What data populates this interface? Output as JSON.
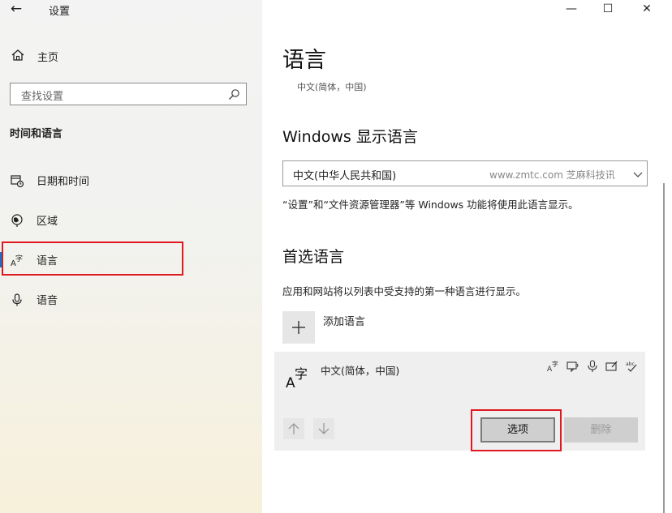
{
  "app": {
    "title": "设置"
  },
  "sidebar": {
    "home_label": "主页",
    "search_placeholder": "查找设置",
    "section_heading": "时间和语言",
    "items": [
      {
        "label": "日期和时间",
        "icon": "calendar-clock-icon"
      },
      {
        "label": "区域",
        "icon": "globe-region-icon"
      },
      {
        "label": "语言",
        "icon": "language-icon",
        "selected": true
      },
      {
        "label": "语音",
        "icon": "microphone-icon"
      }
    ]
  },
  "window_controls": {
    "minimize": "—",
    "maximize": "☐",
    "close": "✕"
  },
  "main": {
    "title": "语言",
    "subtitle": "中文(简体，中国)",
    "display_language": {
      "heading": "Windows 显示语言",
      "selected_value": "中文(中华人民共和国)",
      "watermark": "www.zmtc.com 芝麻科技讯",
      "description": "“设置”和“文件资源管理器”等 Windows 功能将使用此语言显示。"
    },
    "preferred": {
      "heading": "首选语言",
      "description": "应用和网站将以列表中受支持的第一种语言进行显示。",
      "add_label": "添加语言",
      "languages": [
        {
          "name": "中文(简体，中国)",
          "glyph": "字"
        }
      ],
      "options_label": "选项",
      "delete_label": "删除"
    }
  },
  "colors": {
    "accent": "#0078d7",
    "highlight_red": "#e0181f",
    "card_bg": "#efefef"
  }
}
